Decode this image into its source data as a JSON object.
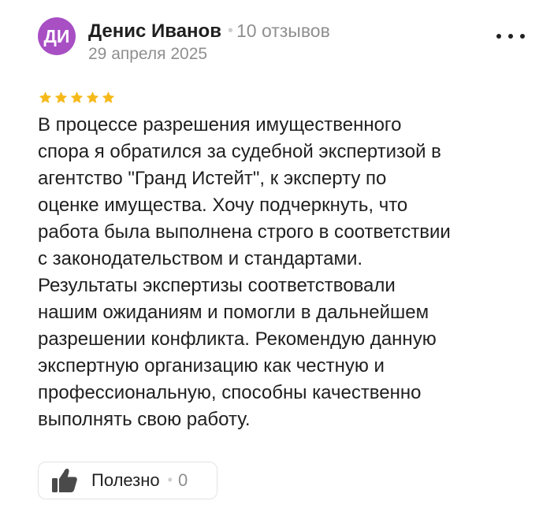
{
  "review": {
    "author": {
      "avatar_initials": "ДИ",
      "avatar_color": "#a84fc4",
      "name": "Денис Иванов",
      "review_count": "10 отзывов"
    },
    "date": "29 апреля 2025",
    "rating": 5,
    "rating_max": 5,
    "star_color": "#f6b91b",
    "text": "В процессе разрешения имущественного\nспора я обратился за судебной экспертизой в\nагентство \"Гранд Истейт\", к эксперту по\nоценке имущества. Хочу подчеркнуть, что\nработа была выполнена строго в соответствии\nс законодательством и стандартами.\nРезультаты экспертизы соответствовали\nнашим ожиданиям и помогли в дальнейшем\nразрешении конфликта. Рекомендую данную\nэкспертную организацию как честную и\nпрофессиональную, способны качественно\nвыполнять свою работу.",
    "more_icon": "ellipsis-icon",
    "useful": {
      "icon": "thumbs-up-icon",
      "label": "Полезно",
      "count": "0"
    }
  }
}
